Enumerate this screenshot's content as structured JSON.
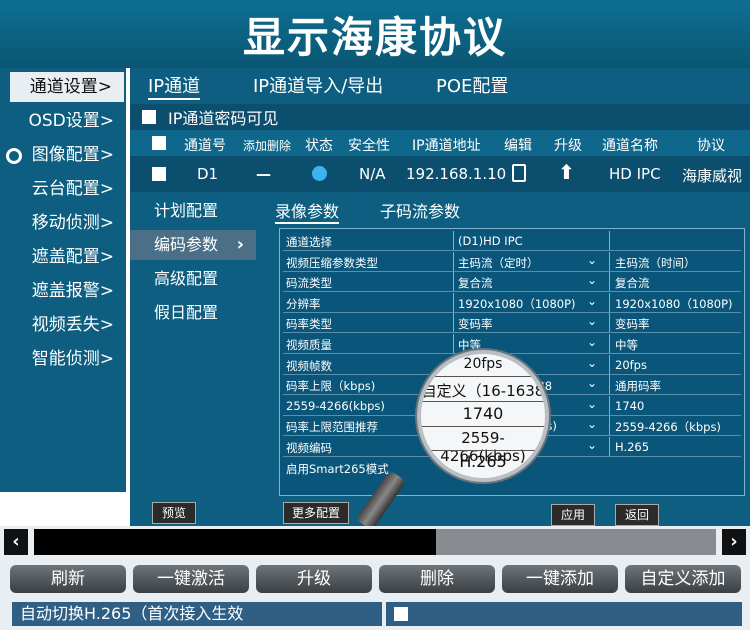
{
  "title": "显示海康协议",
  "left_nav": {
    "items": [
      {
        "label": "通道设置>"
      },
      {
        "label": "OSD设置>"
      },
      {
        "label": "图像配置>"
      },
      {
        "label": "云台配置>"
      },
      {
        "label": "移动侦测>"
      },
      {
        "label": "遮盖配置>"
      },
      {
        "label": "遮盖报警>"
      },
      {
        "label": "视频丢失>"
      },
      {
        "label": "智能侦测>"
      }
    ]
  },
  "tabs": [
    "IP通道",
    "IP通道导入/导出",
    "POE配置"
  ],
  "password_visible_label": "IP通道密码可见",
  "channel_table": {
    "headers": [
      "通道号",
      "添加删除",
      "状态",
      "安全性",
      "IP通道地址",
      "编辑",
      "升级",
      "通道名称",
      "协议"
    ],
    "row": {
      "channel": "D1",
      "delete": "—",
      "security": "N/A",
      "ip": "192.168.1.10",
      "name": "HD IPC",
      "protocol": "海康威视"
    }
  },
  "sub_nav": [
    "计划配置",
    "编码参数",
    "高级配置",
    "假日配置"
  ],
  "sub_nav_arrow": "›",
  "record_tabs": [
    "录像参数",
    "子码流参数"
  ],
  "params": {
    "rows": [
      {
        "label": "通道选择",
        "main": "(D1)HD IPC",
        "sub": ""
      },
      {
        "label": "视频压缩参数类型",
        "main": "主码流（定时）",
        "sub": "主码流（时间）"
      },
      {
        "label": "码流类型",
        "main": "复合流",
        "sub": "复合流"
      },
      {
        "label": "分辨率",
        "main": "1920x1080（1080P)",
        "sub": "1920x1080（1080P)"
      },
      {
        "label": "码率类型",
        "main": "变码率",
        "sub": "变码率"
      },
      {
        "label": "视频质量",
        "main": "中等",
        "sub": "中等"
      },
      {
        "label": "视频帧数",
        "main": "20fps",
        "sub": "20fps"
      },
      {
        "label": "码率上限（kbps)",
        "main": "自定义（16-1638",
        "sub": "通用码率"
      },
      {
        "label": "2559-4266(kbps)",
        "main": "1740",
        "sub": "1740"
      },
      {
        "label": "码率上限范围推荐",
        "main": "2559-4266(kbps)",
        "sub": "2559-4266（kbps)"
      },
      {
        "label": "视频编码",
        "main": "H.265",
        "sub": "H.265"
      },
      {
        "label": "启用Smart265模式",
        "main": "",
        "sub": ""
      }
    ]
  },
  "magnifier": [
    "20fps",
    "自定义（16-1638",
    "1740",
    "2559-4266(kbps)",
    "H.265"
  ],
  "buttons": {
    "preview": "预览",
    "more": "更多配置",
    "apply": "应用",
    "back": "返回"
  },
  "scroll": {
    "left": "‹",
    "right": "›",
    "position": 0.59
  },
  "actions": [
    "刷新",
    "一键激活",
    "升级",
    "删除",
    "一键添加",
    "自定义添加"
  ],
  "auto_switch_label": "自动切换H.265（首次接入生效"
}
